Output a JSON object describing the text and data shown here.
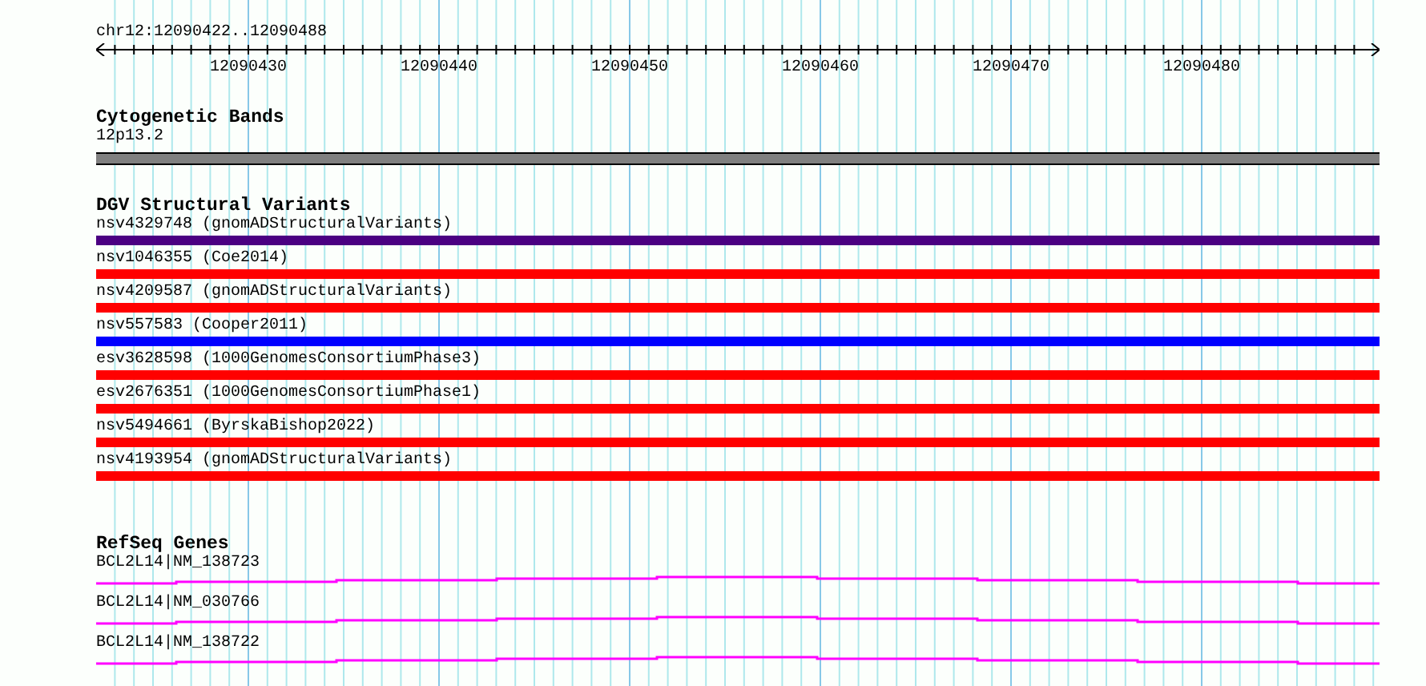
{
  "ruler": {
    "location": "chr12:12090422..12090488",
    "ticks": [
      "12090430",
      "12090440",
      "12090450",
      "12090460",
      "12090470",
      "12090480"
    ]
  },
  "cytoband_track": {
    "title": "Cytogenetic Bands",
    "band": {
      "label": "12p13.2",
      "color": "#808080"
    }
  },
  "variant_track": {
    "title": "DGV Structural Variants",
    "variants": [
      {
        "label": "nsv4329748 (gnomADStructuralVariants)",
        "color": "#4b0082"
      },
      {
        "label": "nsv1046355 (Coe2014)",
        "color": "#ff0000"
      },
      {
        "label": "nsv4209587 (gnomADStructuralVariants)",
        "color": "#ff0000"
      },
      {
        "label": "nsv557583 (Cooper2011)",
        "color": "#0000ff"
      },
      {
        "label": "esv3628598 (1000GenomesConsortiumPhase3)",
        "color": "#ff0000"
      },
      {
        "label": "esv2676351 (1000GenomesConsortiumPhase1)",
        "color": "#ff0000"
      },
      {
        "label": "nsv5494661 (ByrskaBishop2022)",
        "color": "#ff0000"
      },
      {
        "label": "nsv4193954 (gnomADStructuralVariants)",
        "color": "#ff0000"
      }
    ]
  },
  "gene_track": {
    "title": "RefSeq Genes",
    "genes": [
      {
        "label": "BCL2L14|NM_138723"
      },
      {
        "label": "BCL2L14|NM_030766"
      },
      {
        "label": "BCL2L14|NM_138722"
      }
    ]
  }
}
